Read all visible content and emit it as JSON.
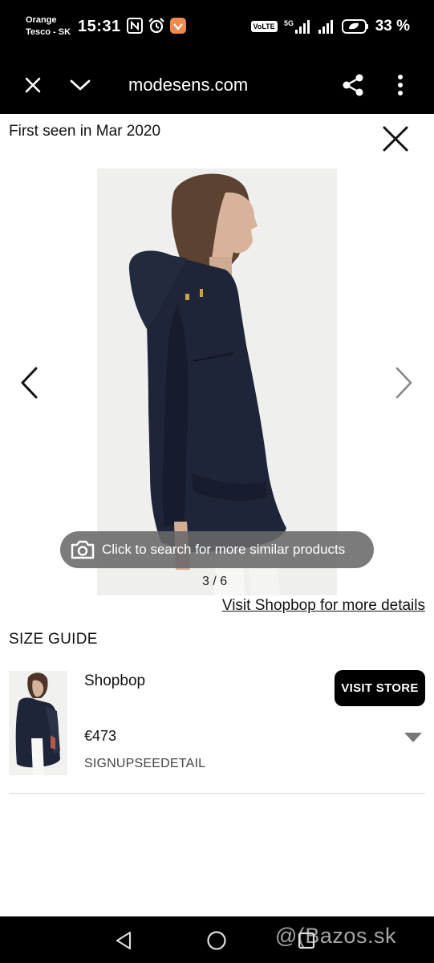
{
  "status_bar": {
    "carrier_line1": "Orange",
    "carrier_line2": "Tesco - SK",
    "time": "15:31",
    "network_badge": "VoLTE",
    "network_gen": "5G",
    "battery": "33 %"
  },
  "browser": {
    "url": "modesens.com"
  },
  "product": {
    "first_seen": "First seen in Mar 2020",
    "image_counter": "3 / 6",
    "search_similar": "Click to search for more similar products",
    "visit_link": "Visit Shopbop for more details",
    "size_guide": "SIZE GUIDE"
  },
  "listing": {
    "store": "Shopbop",
    "visit_button": "VISIT STORE",
    "price": "€473",
    "promo": "SIGNUPSEEDETAIL"
  },
  "watermark": "@(Bazos.sk",
  "colors": {
    "accent": "#000000",
    "jacket": "#1e2538"
  }
}
